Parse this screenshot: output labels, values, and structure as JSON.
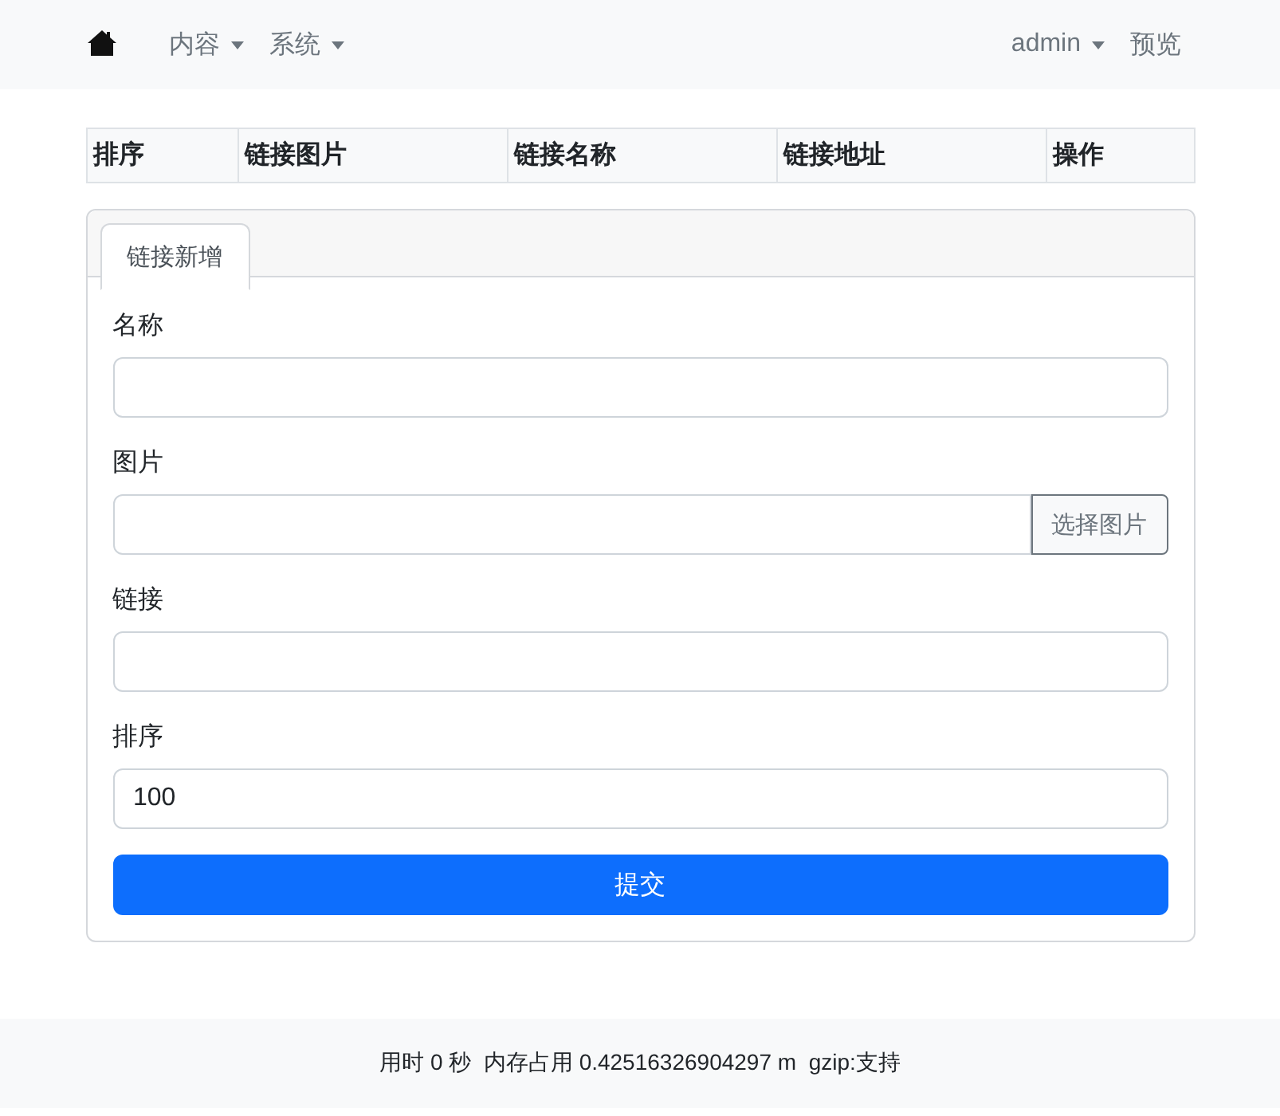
{
  "navbar": {
    "left": [
      {
        "label": "内容",
        "dropdown": true
      },
      {
        "label": "系统",
        "dropdown": true
      }
    ],
    "right": [
      {
        "label": "admin",
        "dropdown": true
      },
      {
        "label": "预览",
        "dropdown": false
      }
    ]
  },
  "table": {
    "columns": [
      "排序",
      "链接图片",
      "链接名称",
      "链接地址",
      "操作"
    ]
  },
  "card": {
    "tabs": [
      {
        "label": "链接新增",
        "selected": true
      }
    ],
    "fields": [
      {
        "kind": "text",
        "label": "名称"
      },
      {
        "kind": "file",
        "label": "图片",
        "button": "选择图片"
      },
      {
        "kind": "text",
        "label": "链接"
      },
      {
        "kind": "text",
        "label": "排序",
        "value": "100"
      }
    ],
    "submit": "提交"
  },
  "footer": "用时 0 秒  内存占用 0.42516326904297 m  gzip:支持"
}
